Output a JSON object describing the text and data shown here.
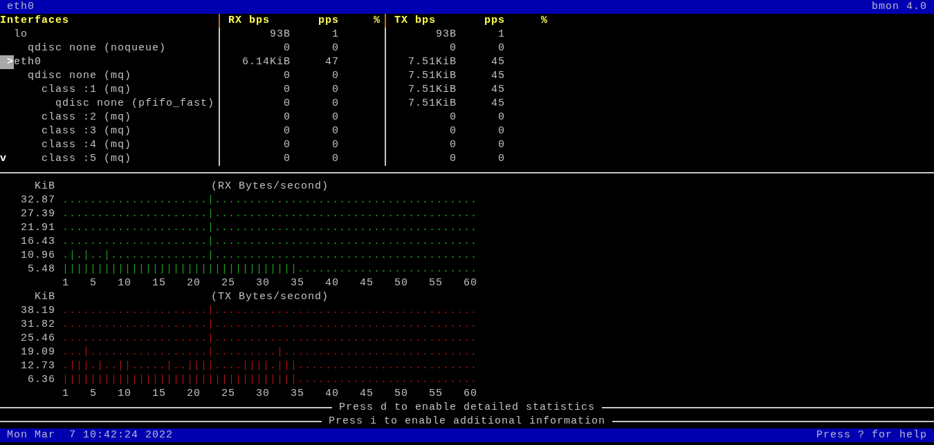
{
  "title_bar": {
    "interface": "eth0",
    "app": "bmon 4.0"
  },
  "interfaces": {
    "columns": [
      "Interfaces",
      "RX bps",
      "pps",
      "%",
      "TX bps",
      "pps",
      "%"
    ],
    "cursor_marker": ">",
    "scroll_indicator": "v",
    "rows": [
      {
        "name": "lo",
        "rx_bps": "93B",
        "rx_pps": "1",
        "tx_bps": "93B",
        "tx_pps": "1",
        "selected": false,
        "children": [
          {
            "name": "qdisc none (noqueue)",
            "rx_bps": "0",
            "rx_pps": "0",
            "tx_bps": "0",
            "tx_pps": "0",
            "selected": false
          }
        ]
      },
      {
        "name": "eth0",
        "rx_bps": "6.14KiB",
        "rx_pps": "47",
        "tx_bps": "7.51KiB",
        "tx_pps": "45",
        "selected": true,
        "children": [
          {
            "name": "qdisc none (mq)",
            "rx_bps": "0",
            "rx_pps": "0",
            "tx_bps": "7.51KiB",
            "tx_pps": "45",
            "selected": false,
            "children": [
              {
                "name": "class :1 (mq)",
                "rx_bps": "0",
                "rx_pps": "0",
                "tx_bps": "7.51KiB",
                "tx_pps": "45",
                "selected": false,
                "children": [
                  {
                    "name": "qdisc none (pfifo_fast)",
                    "rx_bps": "0",
                    "rx_pps": "0",
                    "tx_bps": "7.51KiB",
                    "tx_pps": "45",
                    "selected": false
                  }
                ]
              },
              {
                "name": "class :2 (mq)",
                "rx_bps": "0",
                "rx_pps": "0",
                "tx_bps": "0",
                "tx_pps": "0",
                "selected": false
              },
              {
                "name": "class :3 (mq)",
                "rx_bps": "0",
                "rx_pps": "0",
                "tx_bps": "0",
                "tx_pps": "0",
                "selected": false
              },
              {
                "name": "class :4 (mq)",
                "rx_bps": "0",
                "rx_pps": "0",
                "tx_bps": "0",
                "tx_pps": "0",
                "selected": false
              },
              {
                "name": "class :5 (mq)",
                "rx_bps": "0",
                "rx_pps": "0",
                "tx_bps": "0",
                "tx_pps": "0",
                "selected": false
              }
            ]
          }
        ]
      }
    ]
  },
  "graphs": [
    {
      "unit": "KiB",
      "title": "(RX Bytes/second)",
      "color": "#1ea01e",
      "rows": [
        {
          "label": "32.87",
          "cells": ".....................|......................................"
        },
        {
          "label": "27.39",
          "cells": ".....................|......................................"
        },
        {
          "label": "21.91",
          "cells": ".....................|......................................"
        },
        {
          "label": "16.43",
          "cells": ".....................|......................................"
        },
        {
          "label": "10.96",
          "cells": ".|.|..|..............|......................................"
        },
        {
          "label": "5.48",
          "cells": "||||||||||||||||||||||||||||||||||.........................."
        }
      ],
      "x_ticks": [
        "1",
        "5",
        "10",
        "15",
        "20",
        "25",
        "30",
        "35",
        "40",
        "45",
        "50",
        "55",
        "60"
      ]
    },
    {
      "unit": "KiB",
      "title": "(TX Bytes/second)",
      "color": "#b01010",
      "rows": [
        {
          "label": "38.19",
          "cells": ".....................|......................................"
        },
        {
          "label": "31.82",
          "cells": ".....................|......................................"
        },
        {
          "label": "25.46",
          "cells": ".....................|......................................"
        },
        {
          "label": "19.09",
          "cells": "...|.................|.........|............................"
        },
        {
          "label": "12.73",
          "cells": ".|||.|..||.....|..||||....||||.|||.........................."
        },
        {
          "label": "6.36",
          "cells": "||||||||||||||||||||||||||||||||||.........................."
        }
      ],
      "x_ticks": [
        "1",
        "5",
        "10",
        "15",
        "20",
        "25",
        "30",
        "35",
        "40",
        "45",
        "50",
        "55",
        "60"
      ]
    }
  ],
  "footer_hints": [
    "Press d to enable detailed statistics",
    "Press i to enable additional information"
  ],
  "status_bar": {
    "datetime": "Mon Mar  7 10:42:24 2022",
    "help": "Press ? for help"
  }
}
